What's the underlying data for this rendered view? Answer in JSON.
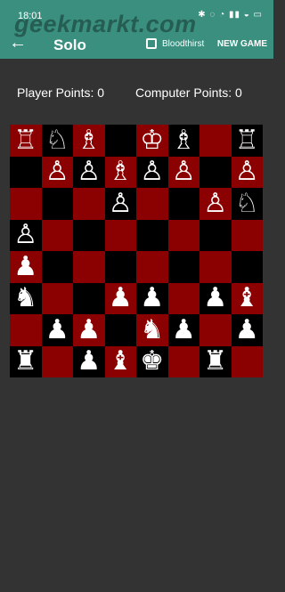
{
  "status_bar": {
    "time": "18:01",
    "icons": "✱ ◌ ◔ ▮▮ ◒ ▭"
  },
  "watermark": "geekmarkt.com",
  "app_bar": {
    "title": "Solo",
    "back_icon": "back-arrow-icon",
    "checkbox_label": "Bloodthirst",
    "new_game_label": "NEW GAME"
  },
  "scores": {
    "player": "Player Points: 0",
    "computer": "Computer Points: 0"
  },
  "colors": {
    "dark_square": "#000000",
    "light_square": "#8b0000",
    "bar": "#3a8f7e",
    "background": "#333333"
  },
  "board": {
    "rows": [
      [
        "R",
        "N",
        "B",
        "",
        "K",
        "B",
        "",
        "R"
      ],
      [
        "",
        "P",
        "P",
        "B",
        "P",
        "P",
        "",
        "P"
      ],
      [
        "",
        "",
        "",
        "P",
        "",
        "",
        "P",
        "N"
      ],
      [
        "P",
        "",
        "",
        "",
        "",
        "",
        "",
        ""
      ],
      [
        "p",
        "",
        "",
        "",
        "",
        "",
        "",
        ""
      ],
      [
        "n",
        "",
        "",
        "p",
        "p",
        "",
        "p",
        "b"
      ],
      [
        "",
        "p",
        "p",
        "",
        "n",
        "p",
        "",
        "p"
      ],
      [
        "r",
        "",
        "p",
        "b",
        "k",
        "",
        "r",
        ""
      ]
    ],
    "symbols": {
      "R": "♖",
      "N": "♘",
      "B": "♗",
      "Q": "♕",
      "K": "♔",
      "P": "♙",
      "r": "♜",
      "n": "♞",
      "b": "♝",
      "q": "♛",
      "k": "♚",
      "p": "♟"
    }
  }
}
